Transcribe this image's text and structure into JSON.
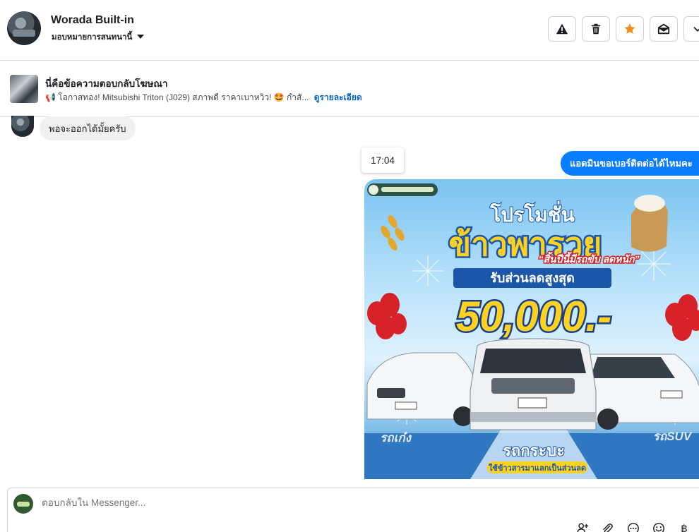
{
  "header": {
    "name": "Worada Built-in",
    "assign_label": "มอบหมายการสนทนานี้",
    "buttons": [
      {
        "name": "report-button",
        "icon": "warning-icon"
      },
      {
        "name": "delete-button",
        "icon": "trash-icon"
      },
      {
        "name": "star-button",
        "icon": "star-icon",
        "color": "#f28c1e"
      },
      {
        "name": "mark-unread-button",
        "icon": "envelope-open-icon"
      },
      {
        "name": "more-button",
        "icon": "chevron-down-icon"
      }
    ]
  },
  "ad": {
    "title": "นี่คือข้อความตอบกลับโฆษณา",
    "emoji_lead": "📢",
    "snippet": "โอกาสทอง! Mitsubishi Triton (J029) สภาพดี ราคาเบาหวิว! 🤩 กำสั...",
    "link": "ดูรายละเอียด"
  },
  "messages": {
    "incoming_text": "พอจะออกได้มั้ยครับ",
    "timestamp": "17:04",
    "outgoing_text": "แอดมินขอเบอร์ติดต่อได้ไหมคะ"
  },
  "promo": {
    "title_small": "โปรโมชั่น",
    "title_big": "ข้าวพารวย",
    "tagline": "“สิ้นปีนี้มีรถขับ ลดหนัก”",
    "discount_label": "รับส่วนลดสูงสุด",
    "amount": "50,000.-",
    "left_label": "รถเก๋ง",
    "center_label": "รถกระบะ",
    "right_label": "รถSUV",
    "bottom_banner": "ใช้ข้าวสารมาแลกเป็นส่วนลด",
    "accent_yellow": "#ffd21f",
    "accent_blue": "#1b56a8"
  },
  "composer": {
    "placeholder": "ตอบกลับใน Messenger...",
    "currency_symbol": "฿",
    "tools": [
      "add-person-icon",
      "paperclip-icon",
      "more-dots-icon",
      "emoji-icon",
      "currency-icon"
    ]
  }
}
